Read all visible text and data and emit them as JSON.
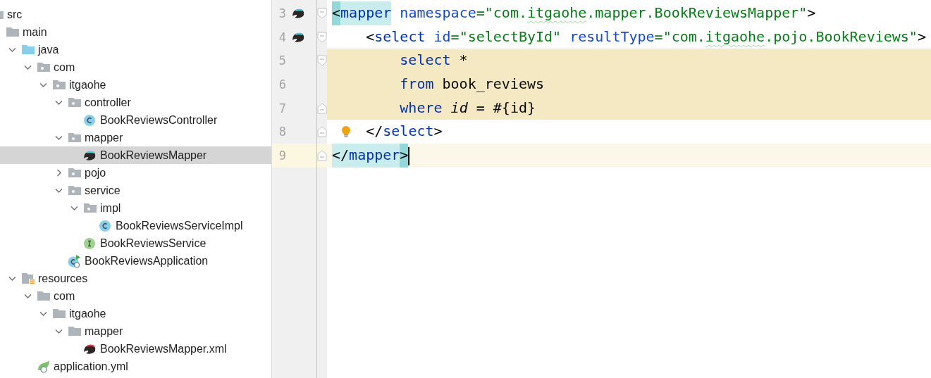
{
  "project_tree": [
    {
      "label": "src",
      "kind": "folder",
      "children": [
        {
          "label": "main",
          "kind": "folder",
          "children": [
            {
              "label": "java",
              "kind": "source-folder",
              "expanded": true,
              "children": [
                {
                  "label": "com",
                  "kind": "package",
                  "expanded": true,
                  "children": [
                    {
                      "label": "itgaohe",
                      "kind": "package",
                      "expanded": true,
                      "children": [
                        {
                          "label": "controller",
                          "kind": "package",
                          "expanded": true,
                          "children": [
                            {
                              "label": "BookReviewsController",
                              "kind": "class",
                              "selected": false
                            }
                          ]
                        },
                        {
                          "label": "mapper",
                          "kind": "package",
                          "expanded": true,
                          "children": [
                            {
                              "label": "BookReviewsMapper",
                              "kind": "mybatis",
                              "selected": true
                            }
                          ]
                        },
                        {
                          "label": "pojo",
                          "kind": "package",
                          "expanded": false
                        },
                        {
                          "label": "service",
                          "kind": "package",
                          "expanded": true,
                          "children": [
                            {
                              "label": "impl",
                              "kind": "package",
                              "expanded": true,
                              "children": [
                                {
                                  "label": "BookReviewsServiceImpl",
                                  "kind": "class",
                                  "selected": false
                                }
                              ]
                            },
                            {
                              "label": "BookReviewsService",
                              "kind": "interface",
                              "selected": false
                            }
                          ]
                        },
                        {
                          "label": "BookReviewsApplication",
                          "kind": "app",
                          "selected": false
                        }
                      ]
                    }
                  ]
                }
              ]
            },
            {
              "label": "resources",
              "kind": "resources",
              "expanded": true,
              "children": [
                {
                  "label": "com",
                  "kind": "folder",
                  "expanded": true,
                  "children": [
                    {
                      "label": "itgaohe",
                      "kind": "folder",
                      "expanded": true,
                      "children": [
                        {
                          "label": "mapper",
                          "kind": "folder",
                          "expanded": true,
                          "children": [
                            {
                              "label": "BookReviewsMapper.xml",
                              "kind": "mybatis-xml",
                              "selected": false
                            }
                          ]
                        }
                      ]
                    }
                  ]
                },
                {
                  "label": "application.yml",
                  "kind": "yml",
                  "selected": false
                }
              ]
            }
          ]
        }
      ]
    }
  ],
  "editor": {
    "lines": [
      {
        "number": "3",
        "mapper_icon": true,
        "fold_start": true,
        "injected": false,
        "current": false,
        "tokens": [
          {
            "kind": "punct",
            "text": "<",
            "match": true,
            "cursor_match": true
          },
          {
            "kind": "tag",
            "text": "mapper",
            "match": true,
            "cursor_match": false
          },
          {
            "kind": "attr",
            "text": " namespace"
          },
          {
            "kind": "value",
            "text": "=\"com."
          },
          {
            "kind": "value",
            "text": "itgaohe",
            "typo": true
          },
          {
            "kind": "value",
            "text": ".mapper.BookReviewsMapper\""
          },
          {
            "kind": "punct",
            "text": ">"
          }
        ]
      },
      {
        "number": "4",
        "mapper_icon": true,
        "fold_start": true,
        "injected": false,
        "current": false,
        "tokens": [
          {
            "kind": "punct",
            "text": "    <"
          },
          {
            "kind": "tag",
            "text": "select"
          },
          {
            "kind": "attr",
            "text": " id"
          },
          {
            "kind": "value",
            "text": "=\"selectById\""
          },
          {
            "kind": "attr",
            "text": " resultType"
          },
          {
            "kind": "value",
            "text": "=\"com."
          },
          {
            "kind": "value",
            "text": "itgaohe",
            "typo": true
          },
          {
            "kind": "value",
            "text": ".pojo.BookReviews\""
          },
          {
            "kind": "punct",
            "text": ">"
          }
        ]
      },
      {
        "number": "5",
        "fold_start": true,
        "injected": true,
        "current": false,
        "tokens": [
          {
            "kind": "keyword",
            "text": "        select"
          },
          {
            "kind": "italic",
            "text": " *"
          }
        ]
      },
      {
        "number": "6",
        "injected": true,
        "current": false,
        "tokens": [
          {
            "kind": "keyword",
            "text": "        from"
          },
          {
            "kind": "punct",
            "text": " book_reviews"
          }
        ]
      },
      {
        "number": "7",
        "fold_end": true,
        "injected": true,
        "current": false,
        "tokens": [
          {
            "kind": "keyword",
            "text": "        where"
          },
          {
            "kind": "italic",
            "text": " id"
          },
          {
            "kind": "punct",
            "text": " = #{id}"
          }
        ]
      },
      {
        "number": "8",
        "fold_end": true,
        "injected": false,
        "current": false,
        "bulb": true,
        "tokens": [
          {
            "kind": "punct",
            "text": "    </"
          },
          {
            "kind": "tag",
            "text": "select"
          },
          {
            "kind": "punct",
            "text": ">"
          }
        ]
      },
      {
        "number": "9",
        "fold_end": true,
        "injected": false,
        "current": true,
        "caret": true,
        "tokens": [
          {
            "kind": "punct",
            "text": "</",
            "match": true,
            "cursor_match": false
          },
          {
            "kind": "tag",
            "text": "mapper",
            "match": true,
            "cursor_match": false
          },
          {
            "kind": "punct",
            "text": ">",
            "match": true,
            "cursor_match": true
          }
        ]
      }
    ]
  }
}
